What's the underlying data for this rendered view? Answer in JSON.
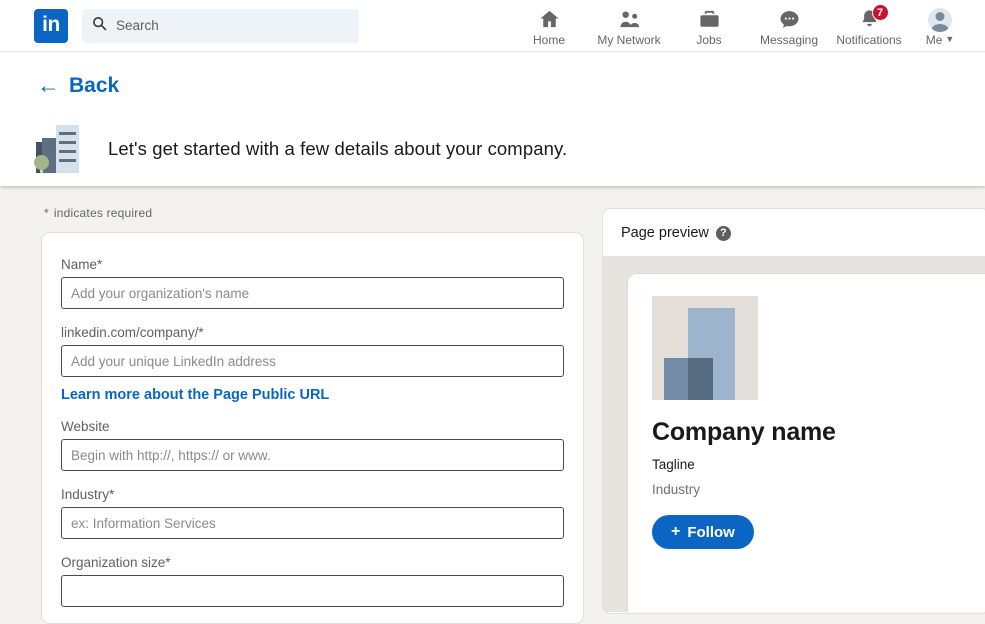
{
  "nav": {
    "logo_alt": "in",
    "search_placeholder": "Search",
    "items": [
      {
        "label": "Home",
        "icon": "home-icon"
      },
      {
        "label": "My Network",
        "icon": "network-icon"
      },
      {
        "label": "Jobs",
        "icon": "briefcase-icon"
      },
      {
        "label": "Messaging",
        "icon": "message-icon"
      },
      {
        "label": "Notifications",
        "icon": "bell-icon",
        "badge": "7"
      },
      {
        "label": "Me",
        "icon": "avatar-icon"
      }
    ]
  },
  "sub_header": {
    "back_label": "Back",
    "back_arrow": "←",
    "intro": "Let's get started with a few details about your company."
  },
  "form": {
    "required_note": "indicates required",
    "required_star": "*",
    "learn_more_link": "Learn more about the Page Public URL",
    "fields": [
      {
        "label": "Name*",
        "placeholder": "Add your organization's name",
        "value": ""
      },
      {
        "label": "linkedin.com/company/*",
        "placeholder": "Add your unique LinkedIn address",
        "value": ""
      },
      {
        "label": "Website",
        "placeholder": "Begin with http://, https:// or www.",
        "value": ""
      },
      {
        "label": "Industry*",
        "placeholder": "ex: Information Services",
        "value": ""
      },
      {
        "label": "Organization size*",
        "placeholder": "",
        "value": ""
      }
    ]
  },
  "preview": {
    "title": "Page preview",
    "help_glyph": "?",
    "company_name": "Company name",
    "tagline": "Tagline",
    "industry": "Industry",
    "follow_label": "Follow",
    "follow_plus": "+"
  },
  "colors": {
    "brand_blue": "#0a66c2",
    "badge_red": "#cb112d",
    "page_bg": "#f3f2ef",
    "preview_stage": "#e7e3de"
  }
}
